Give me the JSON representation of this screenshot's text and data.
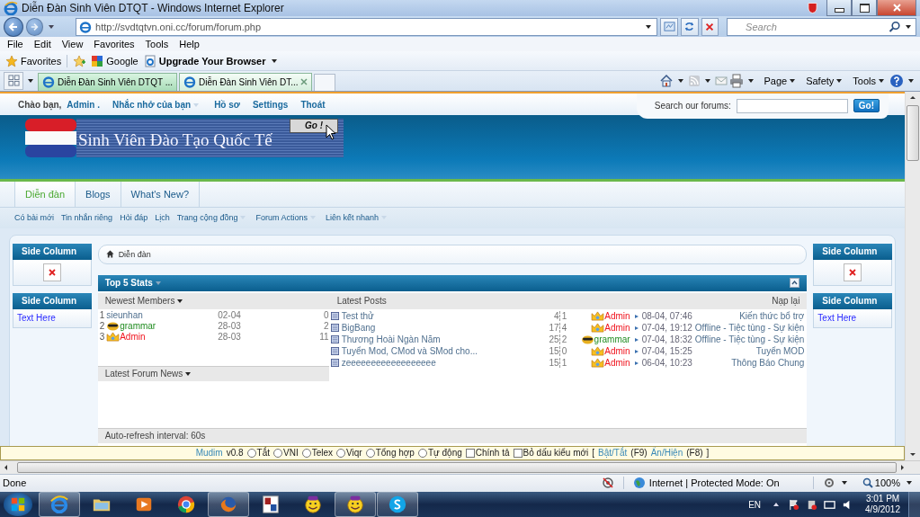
{
  "window": {
    "title": "Diễn Đàn Sinh Viên DTQT - Windows Internet Explorer"
  },
  "address_bar": {
    "url": "http://svdtqtvn.oni.cc/forum/forum.php"
  },
  "search": {
    "placeholder": "Search"
  },
  "menu": [
    "File",
    "Edit",
    "View",
    "Favorites",
    "Tools",
    "Help"
  ],
  "favorites_bar": {
    "favorites": "Favorites",
    "links": [
      {
        "label": "Google",
        "kind": "google"
      },
      {
        "label": "Upgrade Your Browser",
        "kind": "feed"
      }
    ]
  },
  "tabs": [
    {
      "label": "Diễn Đàn Sinh Viên DTQT ...",
      "selected": false
    },
    {
      "label": "Diễn Đàn Sinh Viên DT...",
      "selected": true
    }
  ],
  "command_bar": [
    "Page",
    "Safety",
    "Tools"
  ],
  "forum": {
    "welcome": "Chào bạn,",
    "user": "Admin .",
    "user_links": [
      {
        "label": "Nhắc nhở của bạn",
        "dropdown": true
      },
      {
        "label": "Hồ sơ",
        "dropdown": false
      },
      {
        "label": "Settings",
        "dropdown": false
      },
      {
        "label": "Thoát",
        "dropdown": false
      }
    ],
    "search_label": "Search our forums:",
    "search_button": "Go!",
    "logo": {
      "title": "Sinh Viên Đào Tạo Quốc Tế",
      "button": "Go !"
    },
    "nav_tabs": [
      {
        "label": "Diễn đàn",
        "selected": true
      },
      {
        "label": "Blogs",
        "selected": false
      },
      {
        "label": "What's New?",
        "selected": false
      }
    ],
    "sub_nav": [
      {
        "label": "Có bài mới",
        "dropdown": false
      },
      {
        "label": "Tin nhắn riêng",
        "dropdown": false
      },
      {
        "label": "Hỏi đáp",
        "dropdown": false
      },
      {
        "label": "Lịch",
        "dropdown": false
      },
      {
        "label": "Trang cộng đồng",
        "dropdown": true
      },
      {
        "label": "Forum Actions",
        "dropdown": true
      },
      {
        "label": "Liên kết nhanh",
        "dropdown": true
      }
    ],
    "breadcrumb": "Diễn đàn",
    "stats": {
      "title": "Top 5 Stats",
      "members_heading": "Newest Members",
      "posts_heading": "Latest Posts",
      "reload": "Nạp lại",
      "members": [
        {
          "rank": "1",
          "name": "sieunhan",
          "kind": "member",
          "date": "02-04",
          "count": "0"
        },
        {
          "rank": "2",
          "name": "grammar",
          "kind": "mod",
          "date": "28-03",
          "count": "2"
        },
        {
          "rank": "3",
          "name": "Admin",
          "kind": "admin",
          "date": "28-03",
          "count": "11"
        }
      ],
      "posts": [
        {
          "title": "Test thử",
          "replies": "4",
          "views": "1",
          "poster": "Admin",
          "kind": "admin",
          "date": "08-04, 07:46",
          "forum": "Kiến thức bổ trợ"
        },
        {
          "title": "BigBang",
          "replies": "17",
          "views": "4",
          "poster": "Admin",
          "kind": "admin",
          "date": "07-04, 19:12",
          "forum": "Offline - Tiệc tùng - Sự kiện"
        },
        {
          "title": "Thương Hoài Ngàn Năm",
          "replies": "25",
          "views": "2",
          "poster": "grammar",
          "kind": "mod",
          "date": "07-04, 18:32",
          "forum": "Offline - Tiệc tùng - Sự kiện"
        },
        {
          "title": "Tuyển Mod, CMod và SMod cho...",
          "replies": "15",
          "views": "0",
          "poster": "Admin",
          "kind": "admin",
          "date": "07-04, 15:25",
          "forum": "Tuyển MOD"
        },
        {
          "title": "zeeeeeeeeeeeeeeeeee",
          "replies": "15",
          "views": "1",
          "poster": "Admin",
          "kind": "admin",
          "date": "06-04, 10:23",
          "forum": "Thông Báo Chung"
        }
      ],
      "news_heading": "Latest Forum News",
      "footer": "Auto-refresh interval: 60s"
    },
    "side_columns": {
      "left": [
        {
          "title": "Side Column",
          "kind": "image"
        },
        {
          "title": "Side Column",
          "kind": "text",
          "text": "Text Here"
        }
      ],
      "right": [
        {
          "title": "Side Column",
          "kind": "image"
        },
        {
          "title": "Side Column",
          "kind": "text",
          "text": "Text Here"
        }
      ]
    }
  },
  "mudim": {
    "name": "Mudim",
    "version": "v0.8",
    "modes": [
      {
        "label": "Tắt",
        "selected": false
      },
      {
        "label": "VNI",
        "selected": false
      },
      {
        "label": "Telex",
        "selected": false
      },
      {
        "label": "Viqr",
        "selected": false
      },
      {
        "label": "Tổng hợp",
        "selected": false
      },
      {
        "label": "Tự động",
        "selected": false
      }
    ],
    "options": [
      {
        "label": "Chính tả",
        "checked": false
      },
      {
        "label": "Bỏ dấu kiểu mới",
        "checked": false
      }
    ],
    "open": "[",
    "hotkeys": [
      {
        "label": "Bật/Tắt",
        "key": "(F9)"
      },
      {
        "label": "Ẩn/Hiện",
        "key": "(F8)"
      }
    ],
    "close": "]"
  },
  "status_bar": {
    "status": "Done",
    "zone": "Internet | Protected Mode: On",
    "zoom": "100%"
  },
  "taskbar": {
    "apps": [
      {
        "kind": "ie",
        "running": true
      },
      {
        "kind": "folder",
        "running": false
      },
      {
        "kind": "media",
        "running": false
      },
      {
        "kind": "chrome",
        "running": false
      },
      {
        "kind": "firefox",
        "running": true
      },
      {
        "kind": "dict",
        "running": false
      },
      {
        "kind": "yahoo",
        "running": false
      },
      {
        "kind": "yahoo",
        "running": true
      },
      {
        "kind": "skype",
        "running": true
      }
    ],
    "language": "EN",
    "time": "3:01 PM",
    "date": "4/9/2012"
  }
}
